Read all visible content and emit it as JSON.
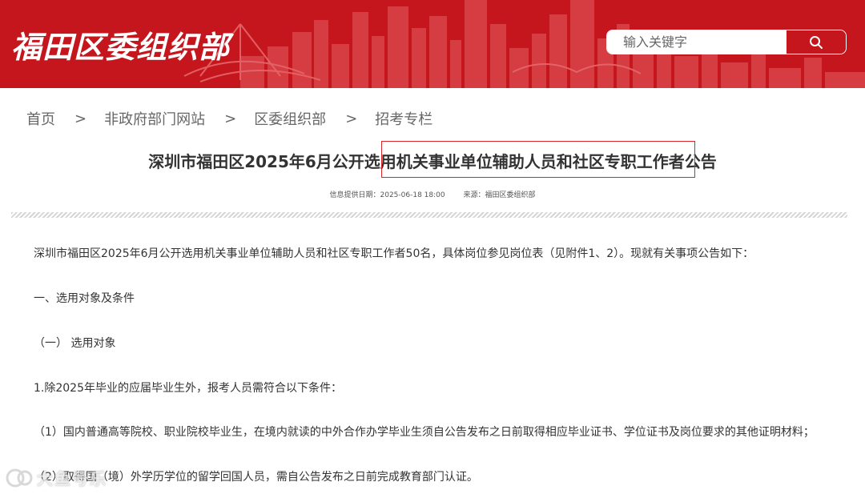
{
  "header": {
    "site_title": "福田区委组织部",
    "search_placeholder": "输入关键字",
    "search_icon": "search-icon",
    "colors": {
      "brand_red": "#c4161c",
      "skyline": "#d9444a"
    }
  },
  "breadcrumb": {
    "separator": ">",
    "items": [
      "首页",
      "非政府部门网站",
      "区委组织部",
      "招考专栏"
    ]
  },
  "article": {
    "title": "深圳市福田区2025年6月公开选用机关事业单位辅助人员和社区专职工作者公告",
    "publish_date": "信息提供日期：2025-06-18 18:00",
    "source": "来源：福田区委组织部",
    "paragraphs": [
      "深圳市福田区2025年6月公开选用机关事业单位辅助人员和社区专职工作者50名，具体岗位参见岗位表（见附件1、2）。现就有关事项公告如下：",
      "一、选用对象及条件",
      "（一） 选用对象",
      "1.除2025年毕业的应届毕业生外，报考人员需符合以下条件：",
      "（1）国内普通高等院校、职业院校毕业生，在境内就读的中外合作办学毕业生须自公告发布之日前取得相应毕业证书、学位证书及岗位要求的其他证明材料；",
      "（2）取得国（境）外学历学位的留学回国人员，需自公告发布之日前完成教育部门认证。"
    ]
  },
  "watermark": {
    "text": "大鱼号乐"
  }
}
